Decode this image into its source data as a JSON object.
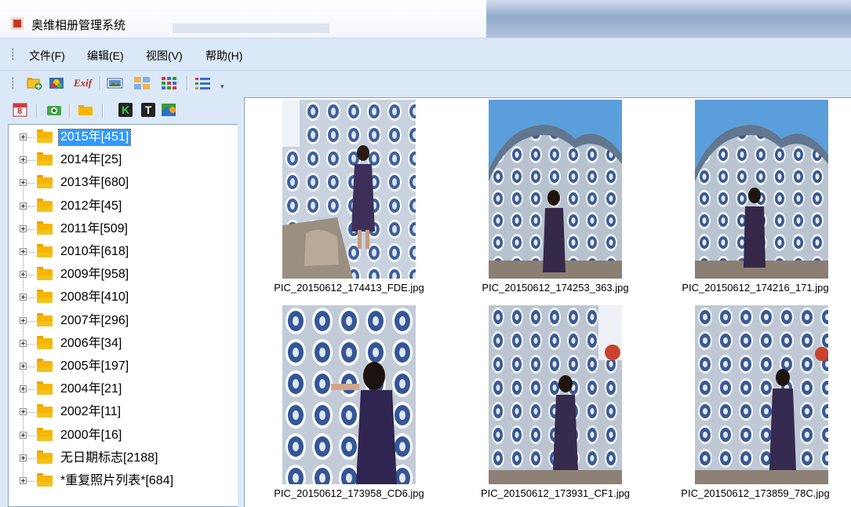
{
  "window": {
    "title": "奥维相册管理系统"
  },
  "menu": [
    {
      "label": "文件(F)"
    },
    {
      "label": "编辑(E)"
    },
    {
      "label": "视图(V)"
    },
    {
      "label": "帮助(H)"
    }
  ],
  "toolbar": {
    "exif_label": "Exif",
    "icons": [
      "add-folder-icon",
      "photo-import-icon",
      "exif-icon",
      "slideshow-icon",
      "large-thumbnail-view-icon",
      "small-icon-view-icon",
      "list-view-icon"
    ]
  },
  "panel_toolbar": {
    "calendar_label": "8",
    "k_label": "K",
    "t_label": "T",
    "icons": [
      "calendar-icon",
      "camera-icon",
      "folder-icon",
      "keyword-icon",
      "tag-icon",
      "map-icon"
    ]
  },
  "tree": [
    {
      "label": "2015年[451]",
      "selected": true
    },
    {
      "label": "2014年[25]"
    },
    {
      "label": "2013年[680]"
    },
    {
      "label": "2012年[45]"
    },
    {
      "label": "2011年[509]"
    },
    {
      "label": "2010年[618]"
    },
    {
      "label": "2009年[958]"
    },
    {
      "label": "2008年[410]"
    },
    {
      "label": "2007年[296]"
    },
    {
      "label": "2006年[34]"
    },
    {
      "label": "2005年[197]"
    },
    {
      "label": "2004年[21]"
    },
    {
      "label": "2002年[11]"
    },
    {
      "label": "2000年[16]"
    },
    {
      "label": "无日期标志[2188]"
    },
    {
      "label": "*重复照片列表*[684]"
    }
  ],
  "thumbnails": [
    {
      "caption": "PIC_20150612_174413_FDE.jpg"
    },
    {
      "caption": "PIC_20150612_174253_363.jpg"
    },
    {
      "caption": "PIC_20150612_174216_171.jpg"
    },
    {
      "caption": "PIC_20150612_173958_CD6.jpg"
    },
    {
      "caption": "PIC_20150612_173931_CF1.jpg"
    },
    {
      "caption": "PIC_20150612_173859_78C.jpg"
    }
  ],
  "colors": {
    "chrome": "#dbe8f7",
    "selection": "#3399ff",
    "folder": "#f7b500"
  }
}
